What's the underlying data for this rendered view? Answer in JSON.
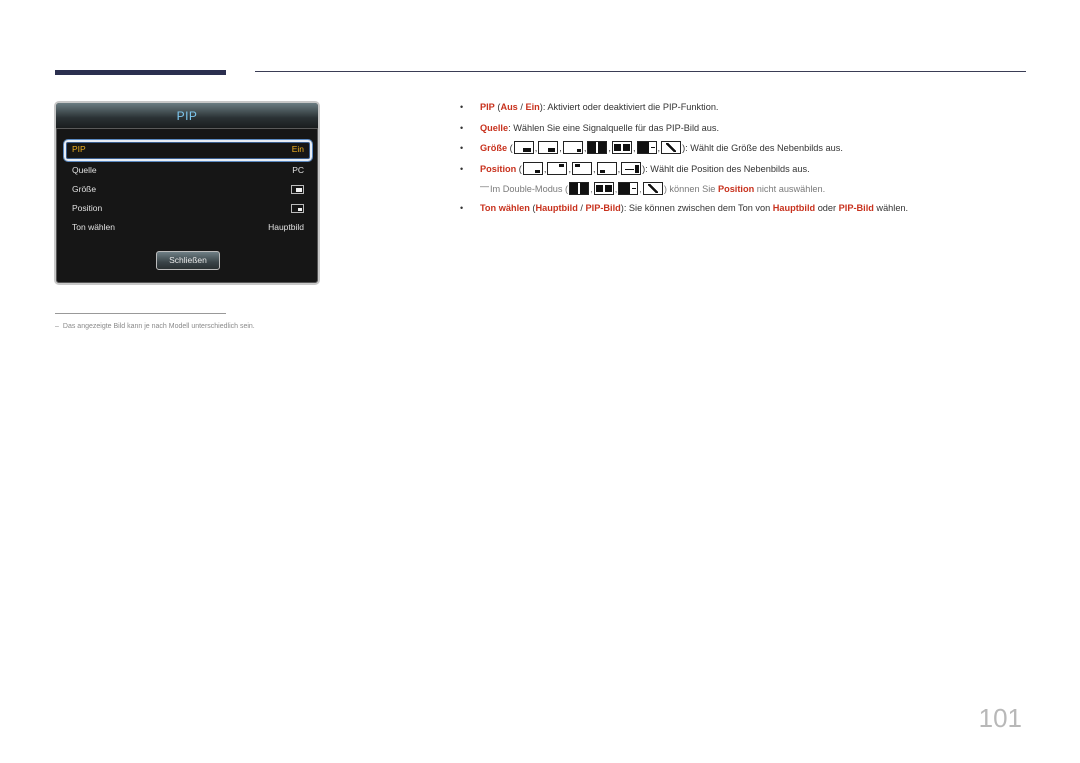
{
  "header": {},
  "osd": {
    "title": "PIP",
    "rows": [
      {
        "label": "PIP",
        "value": "Ein"
      },
      {
        "label": "Quelle",
        "value": "PC"
      },
      {
        "label": "Größe",
        "value_icon": "pip-size-icon"
      },
      {
        "label": "Position",
        "value_icon": "pip-position-icon"
      },
      {
        "label": "Ton wählen",
        "value": "Hauptbild"
      }
    ],
    "close_label": "Schließen"
  },
  "footnote": {
    "dash": "–",
    "text": "Das angezeigte Bild kann je nach Modell unterschiedlich sein."
  },
  "bullets": {
    "pip": {
      "term": "PIP",
      "open": " (",
      "opt1": "Aus",
      "sep": " / ",
      "opt2": "Ein",
      "close": ")",
      "text": ": Aktiviert oder deaktiviert die PIP-Funktion."
    },
    "quelle": {
      "term": "Quelle",
      "text": ": Wählen Sie eine Signalquelle für das PIP-Bild aus."
    },
    "groesse": {
      "term": "Größe",
      "open": " (",
      "icons": [
        "size-small-icon",
        "size-medium-icon",
        "size-large-icon",
        "double-split-icon",
        "double-wide-icon",
        "double-left-icon",
        "double-diagonal-icon"
      ],
      "text": "): Wählt die Größe des Nebenbilds aus."
    },
    "position": {
      "term": "Position",
      "open": " (",
      "icons": [
        "pos-bottom-right-icon",
        "pos-top-right-icon",
        "pos-top-left-icon",
        "pos-bottom-left-icon",
        "pos-custom-icon"
      ],
      "text": "): Wählt die Position des Nebenbilds aus."
    },
    "note": {
      "dash": "―",
      "prefix": "Im Double-Modus (",
      "icons": [
        "double-split-icon",
        "double-wide-icon",
        "double-left-icon",
        "double-diagonal-icon"
      ],
      "mid": ") können Sie ",
      "term": "Position",
      "suffix": " nicht auswählen."
    },
    "ton": {
      "term": "Ton wählen",
      "open": " (",
      "opt1": "Hauptbild",
      "sep": " / ",
      "opt2": "PIP-Bild",
      "close": ")",
      "text": ": Sie können zwischen dem Ton von ",
      "opt3": "Hauptbild",
      "or": " oder ",
      "opt4": "PIP-Bild",
      "end": " wählen."
    },
    "bullet_char": "•"
  },
  "page_number": "101",
  "colors": {
    "accent_red": "#c8321e",
    "osd_title_blue": "#7ec8f0",
    "osd_selected_yellow": "#f0b020",
    "header_bar": "#2b2f4f"
  }
}
